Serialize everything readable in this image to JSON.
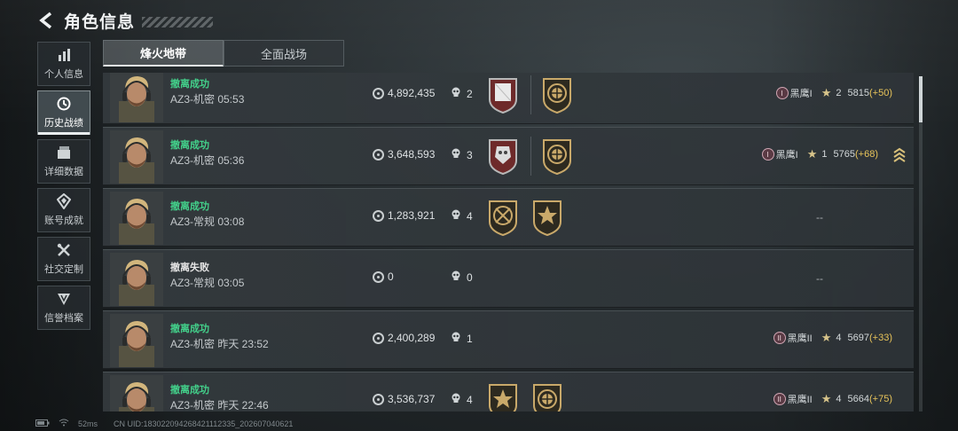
{
  "header": {
    "title": "角色信息"
  },
  "sidebar": {
    "items": [
      {
        "label": "个人信息",
        "icon": "bar-chart-icon"
      },
      {
        "label": "历史战绩",
        "icon": "history-icon",
        "active": true
      },
      {
        "label": "详细数据",
        "icon": "folder-icon"
      },
      {
        "label": "账号成就",
        "icon": "achievement-icon"
      },
      {
        "label": "社交定制",
        "icon": "tools-icon"
      },
      {
        "label": "信誉档案",
        "icon": "shield-icon"
      }
    ]
  },
  "tabs": [
    {
      "label": "烽火地带",
      "active": true
    },
    {
      "label": "全面战场",
      "active": false
    }
  ],
  "records": [
    {
      "status": "撤离成功",
      "result": "success",
      "map": "AZ3-机密 05:53",
      "value": "4,892,435",
      "kills": "2",
      "rank_name": "黑鹰I",
      "rank_tier": "I",
      "stars": "2",
      "score": "5815",
      "gain": "(+50)",
      "medals": [
        "plate-red",
        "gold-emblem"
      ]
    },
    {
      "status": "撤离成功",
      "result": "success",
      "map": "AZ3-机密 05:36",
      "value": "3,648,593",
      "kills": "3",
      "rank_name": "黑鹰I",
      "rank_tier": "I",
      "stars": "1",
      "score": "5765",
      "gain": "(+68)",
      "medals": [
        "plate-red-skull",
        "gold-emblem"
      ],
      "promo": true
    },
    {
      "status": "撤离成功",
      "result": "success",
      "map": "AZ3-常规 03:08",
      "value": "1,283,921",
      "kills": "4",
      "rank_empty": "--",
      "medals": [
        "gold-crossed",
        "gold-star"
      ]
    },
    {
      "status": "撤离失败",
      "result": "fail",
      "map": "AZ3-常规 03:05",
      "value": "0",
      "kills": "0",
      "rank_empty": "--",
      "medals": []
    },
    {
      "status": "撤离成功",
      "result": "success",
      "map": "AZ3-机密 昨天 23:52",
      "value": "2,400,289",
      "kills": "1",
      "rank_name": "黑鹰II",
      "rank_tier": "II",
      "stars": "4",
      "score": "5697",
      "gain": "(+33)",
      "medals": []
    },
    {
      "status": "撤离成功",
      "result": "success",
      "map": "AZ3-机密 昨天 22:46",
      "value": "3,536,737",
      "kills": "4",
      "rank_name": "黑鹰II",
      "rank_tier": "II",
      "stars": "4",
      "score": "5664",
      "gain": "(+75)",
      "medals": [
        "gold-star-burst",
        "gold-emblem"
      ]
    }
  ],
  "footer": {
    "ping": "52ms",
    "uid": "CN UID:18302209426842111233​5_202607040621"
  },
  "colors": {
    "success": "#43d18b",
    "gain": "#e7c35a",
    "accent": "#e9edee"
  }
}
